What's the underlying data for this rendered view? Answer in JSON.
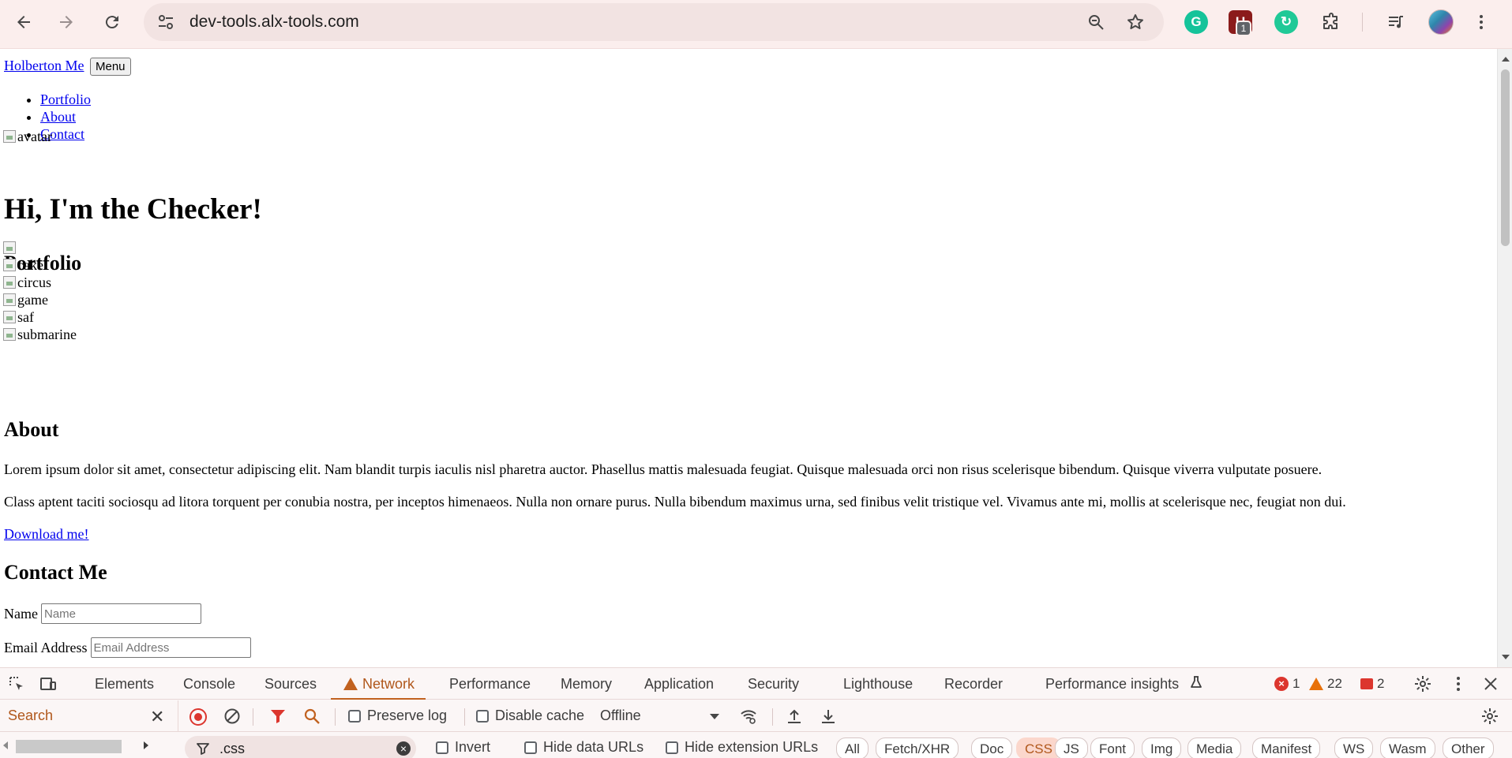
{
  "browser": {
    "url": "dev-tools.alx-tools.com",
    "extension_badge": "1"
  },
  "page": {
    "brand_link": "Holberton Me",
    "menu_button": "Menu",
    "nav_items": [
      "Portfolio",
      "About",
      "Contact"
    ],
    "avatar_alt": "avatar",
    "heading": "Hi, I'm the Checker!",
    "portfolio_heading": "Portfolio",
    "portfolio_images": [
      "cake",
      "circus",
      "game",
      "saf",
      "submarine"
    ],
    "about_heading": "About",
    "about_p1": "Lorem ipsum dolor sit amet, consectetur adipiscing elit. Nam blandit turpis iaculis nisl pharetra auctor. Phasellus mattis malesuada feugiat. Quisque malesuada orci non risus scelerisque bibendum. Quisque viverra vulputate posuere.",
    "about_p2": "Class aptent taciti sociosqu ad litora torquent per conubia nostra, per inceptos himenaeos. Nulla non ornare purus. Nulla bibendum maximus urna, sed finibus velit tristique vel. Vivamus ante mi, mollis at scelerisque nec, feugiat non dui.",
    "download_link": "Download me!",
    "contact_heading": "Contact Me",
    "name_label": "Name",
    "name_placeholder": "Name",
    "email_label": "Email Address",
    "email_placeholder": "Email Address"
  },
  "devtools": {
    "tabs": [
      "Elements",
      "Console",
      "Sources",
      "Network",
      "Performance",
      "Memory",
      "Application",
      "Security",
      "Lighthouse",
      "Recorder",
      "Performance insights"
    ],
    "active_tab": "Network",
    "error_count": "1",
    "warning_count": "22",
    "issue_count": "2",
    "search_label": "Search",
    "preserve_log": "Preserve log",
    "disable_cache": "Disable cache",
    "throttling": "Offline",
    "filter_value": ".css",
    "invert": "Invert",
    "hide_data_urls": "Hide data URLs",
    "hide_extension_urls": "Hide extension URLs",
    "type_filters": [
      "All",
      "Fetch/XHR",
      "Doc",
      "CSS",
      "JS",
      "Font",
      "Img",
      "Media",
      "Manifest",
      "WS",
      "Wasm",
      "Other"
    ],
    "active_type_filter": "CSS"
  },
  "colors": {
    "toolbar_bg": "#fbeeed",
    "accent": "#c1611f",
    "link": "#0000ee",
    "error": "#dc362e"
  }
}
